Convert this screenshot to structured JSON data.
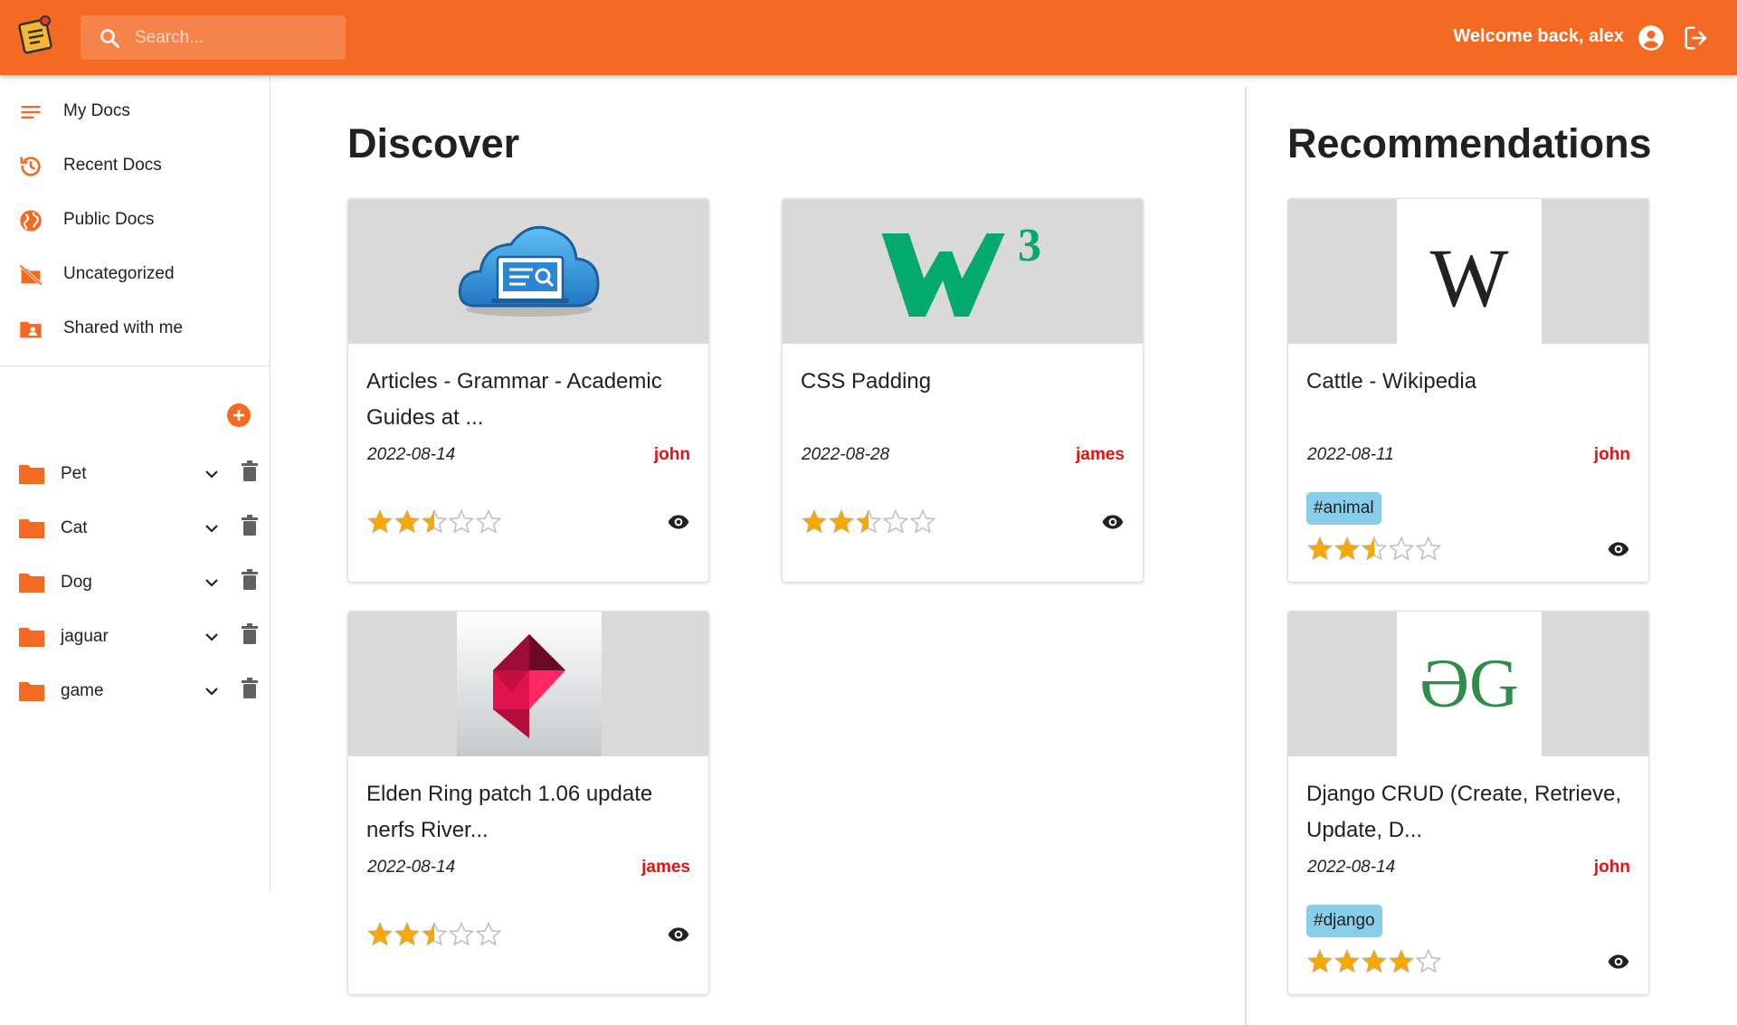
{
  "header": {
    "search_placeholder": "Search...",
    "welcome_text": "Welcome back, alex",
    "brand_color": "#f46a23"
  },
  "sidebar": {
    "nav": [
      {
        "label": "My Docs",
        "icon": "list-icon"
      },
      {
        "label": "Recent Docs",
        "icon": "history-icon"
      },
      {
        "label": "Public Docs",
        "icon": "globe-icon"
      },
      {
        "label": "Uncategorized",
        "icon": "folder-off-icon"
      },
      {
        "label": "Shared with me",
        "icon": "folder-shared-icon"
      }
    ],
    "folders": [
      {
        "label": "Pet"
      },
      {
        "label": "Cat"
      },
      {
        "label": "Dog"
      },
      {
        "label": "jaguar"
      },
      {
        "label": "game"
      }
    ]
  },
  "discover": {
    "heading": "Discover",
    "cards": [
      {
        "title": "Articles - Grammar - Academic Guides at ...",
        "date": "2022-08-14",
        "author": "john",
        "rating": 2.5,
        "thumb": "cloud-search-icon"
      },
      {
        "title": "CSS Padding",
        "date": "2022-08-28",
        "author": "james",
        "rating": 2.5,
        "thumb": "w3-logo"
      },
      {
        "title": "Elden Ring patch 1.06 update nerfs River...",
        "date": "2022-08-14",
        "author": "james",
        "rating": 2.5,
        "thumb": "ruby-logo"
      }
    ]
  },
  "recommendations": {
    "heading": "Recommendations",
    "cards": [
      {
        "title": "Cattle - Wikipedia",
        "date": "2022-08-11",
        "author": "john",
        "tag": "#animal",
        "rating": 2.5,
        "thumb": "wikipedia-logo",
        "logo_text": "W"
      },
      {
        "title": "Django CRUD (Create, Retrieve, Update, D...",
        "date": "2022-08-14",
        "author": "john",
        "tag": "#django",
        "rating": 4,
        "thumb": "gfg-logo",
        "logo_text": "ƏG"
      }
    ]
  }
}
